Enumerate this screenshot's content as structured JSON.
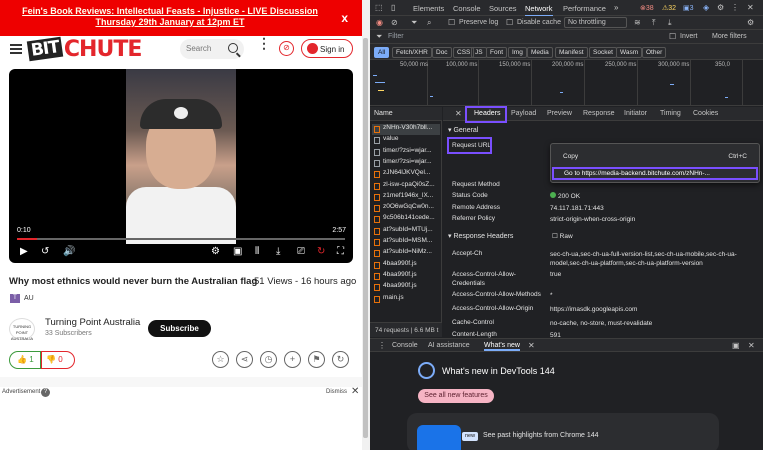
{
  "banner": {
    "text": "Fein's Book Reviews: Intellectual Feasts - Injustice - LIVE Discussion Thursday 29th January at 12pm ET",
    "close": "x"
  },
  "header": {
    "logo_bit": "BIT",
    "logo_chute": "CHUTE",
    "search_placeholder": "Search",
    "signin": "Sign in"
  },
  "player": {
    "current_time": "0:10",
    "total_time": "2:57",
    "progress": 0.06
  },
  "video": {
    "title": "Why most ethnics would never burn the Australian flag",
    "meta": "51 Views - 16 hours ago",
    "tag": "AU"
  },
  "channel": {
    "logo_text": "TURNING POINT AUSTRALIA",
    "name": "Turning Point Australia",
    "subscribers": "33 Subscribers",
    "subscribe": "Subscribe"
  },
  "reactions": {
    "likes": "1",
    "dislikes": "0"
  },
  "ad": {
    "label": "Advertisement",
    "help": "?",
    "dismiss": "Dismiss"
  },
  "devtools": {
    "tabs": [
      "Elements",
      "Console",
      "Sources",
      "Network",
      "Performance"
    ],
    "active_tab": "Network",
    "errors": "38",
    "warnings": "32",
    "infos": "3",
    "toolbar": {
      "preserve_log": "Preserve log",
      "disable_cache": "Disable cache",
      "throttle": "No throttling"
    },
    "filter_placeholder": "Filter",
    "invert": "Invert",
    "more_filters": "More filters",
    "chips": [
      "All",
      "Fetch/XHR",
      "Doc",
      "CSS",
      "JS",
      "Font",
      "Img",
      "Media",
      "Manifest",
      "Socket",
      "Wasm",
      "Other"
    ],
    "timeline_labels": [
      "50,000 ms",
      "100,000 ms",
      "150,000 ms",
      "200,000 ms",
      "250,000 ms",
      "300,000 ms",
      "350,0"
    ],
    "list_header": "Name",
    "requests": [
      "zNHn-V30h7bll...",
      "value",
      "timer/?zsi=wjar...",
      "timer/?zsi=wjar...",
      "zJN64lJKVQel...",
      "zl-isw-cpaQi0sZ...",
      "z1mef1946x_lX...",
      "z0O6wGqCw0n...",
      "9c506b141cede...",
      "at?subId=MTUj...",
      "at?subId=MSM...",
      "at?subId=NiMz...",
      "4baa990f.js",
      "4baa990f.js",
      "4baa990f.js",
      "main.js"
    ],
    "footer": "74 requests | 6.6 MB t",
    "detail_tabs": [
      "Headers",
      "Payload",
      "Preview",
      "Response",
      "Initiator",
      "Timing",
      "Cookies"
    ],
    "general": "General",
    "request_url": "Request URL",
    "context_menu": {
      "copy": "Copy",
      "shortcut": "Ctrl+C",
      "goto": "Go to https://media-backend.bitchute.com/zNHn-..."
    },
    "general_rows": [
      {
        "k": "Request Method",
        "v": ""
      },
      {
        "k": "Status Code",
        "v": "200 OK"
      },
      {
        "k": "Remote Address",
        "v": "74.117.181.71:443"
      },
      {
        "k": "Referrer Policy",
        "v": "strict-origin-when-cross-origin"
      }
    ],
    "response_headers": "Response Headers",
    "raw": "Raw",
    "resp_rows": [
      {
        "k": "Accept-Ch",
        "v": "sec-ch-ua,sec-ch-ua-full-version-list,sec-ch-ua-mobile,sec-ch-ua-model,sec-ch-ua-platform,sec-ch-ua-platform-version"
      },
      {
        "k": "Access-Control-Allow-Credentials",
        "v": "true"
      },
      {
        "k": "Access-Control-Allow-Methods",
        "v": "*"
      },
      {
        "k": "Access-Control-Allow-Origin",
        "v": "https://imasdk.googleapis.com"
      },
      {
        "k": "Cache-Control",
        "v": "no-cache, no-store, must-revalidate"
      },
      {
        "k": "Content-Length",
        "v": "591"
      }
    ],
    "drawer_tabs": [
      "Console",
      "AI assistance",
      "What's new"
    ],
    "whats_new_title": "What's new in DevTools 144",
    "see_all": "See all new features",
    "new_badge": "new",
    "past_highlights": "See past highlights from Chrome 144"
  }
}
